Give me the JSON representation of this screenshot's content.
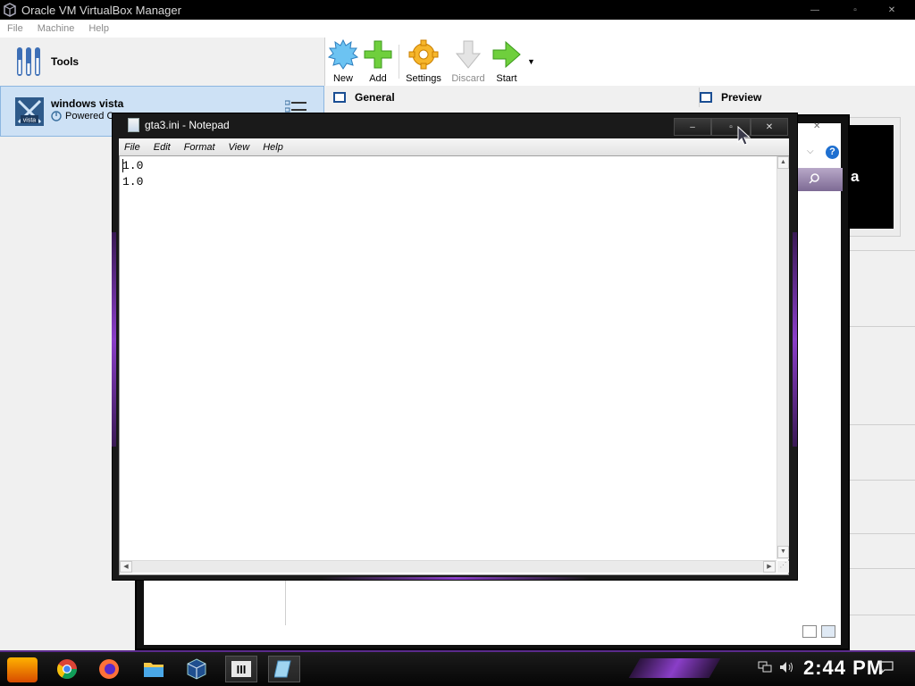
{
  "virtualbox": {
    "title": "Oracle VM VirtualBox Manager",
    "menu": [
      "File",
      "Machine",
      "Help"
    ],
    "tools_label": "Tools",
    "vm": {
      "name": "windows vista",
      "state": "Powered C"
    },
    "toolbar": {
      "new": "New",
      "add": "Add",
      "settings": "Settings",
      "discard": "Discard",
      "start": "Start"
    },
    "sections": {
      "general": "General",
      "preview": "Preview"
    },
    "preview_text": "a"
  },
  "notepad": {
    "title": "gta3.ini - Notepad",
    "menu": [
      "File",
      "Edit",
      "Format",
      "View",
      "Help"
    ],
    "content": "1.0\n1.0"
  },
  "taskbar": {
    "apps": [
      "start-icon",
      "chrome-icon",
      "firefox-icon",
      "file-explorer-icon",
      "virtualbox-icon",
      "game-icon",
      "notepad-icon"
    ],
    "clock": "2:44 PM"
  }
}
